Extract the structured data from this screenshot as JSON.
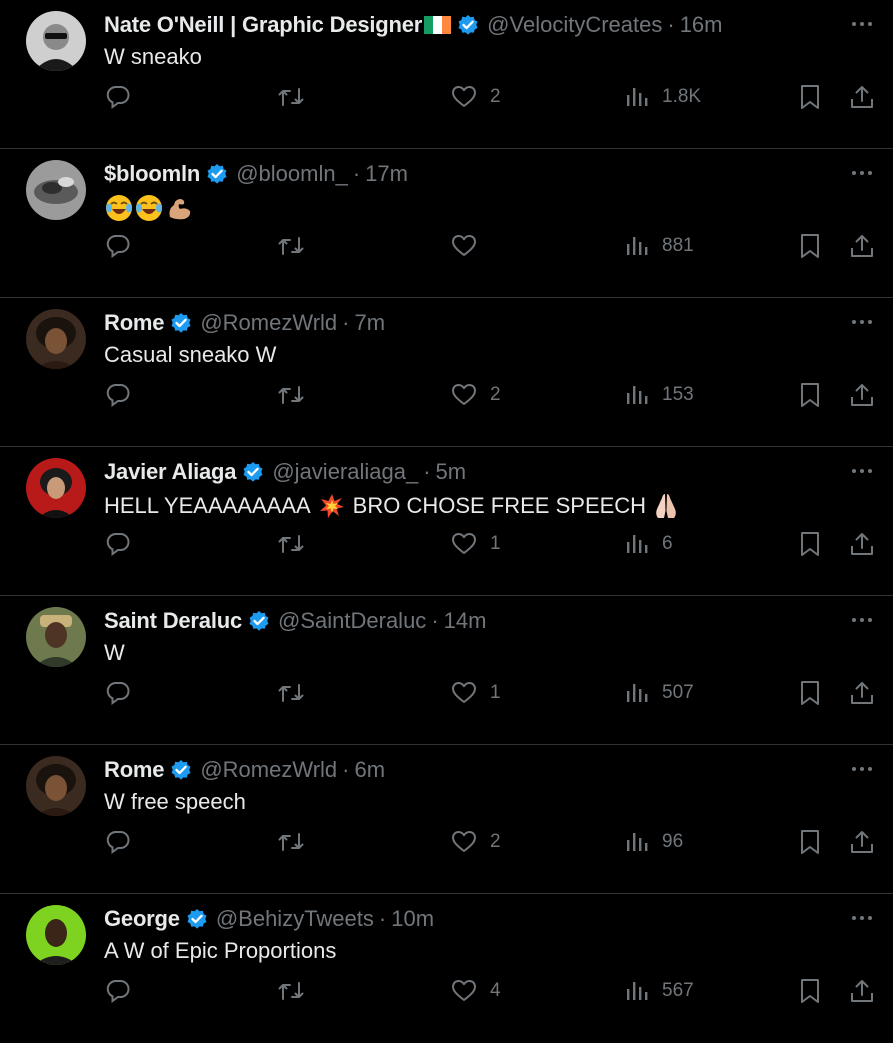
{
  "icons": {
    "reply": "speech-bubble-icon",
    "retweet": "retweet-arrows-icon",
    "like": "heart-icon",
    "views": "bar-chart-icon",
    "bookmark": "bookmark-icon",
    "share": "share-upload-icon",
    "more": "more-dots-icon",
    "verified": "verified-badge-icon"
  },
  "colors": {
    "background": "#000000",
    "text": "#e7e9ea",
    "muted": "#71767b",
    "divider": "#2f3336",
    "verified": "#1d9bf0"
  },
  "tweets": [
    {
      "name": "Nate O'Neill | Graphic Designer",
      "flag": "ireland-flag-icon",
      "handle": "@VelocityCreates",
      "separator": "·",
      "time": "16m",
      "text": "W sneako",
      "likes": "2",
      "views": "1.8K"
    },
    {
      "name": "$bloomln",
      "handle": "@bloomln_",
      "separator": "·",
      "time": "17m",
      "text": "",
      "text_emojis": [
        "face-with-tears-of-joy-emoji",
        "face-with-tears-of-joy-emoji",
        "flexed-biceps-emoji"
      ],
      "likes": "",
      "views": "881"
    },
    {
      "name": "Rome",
      "handle": "@RomezWrld",
      "separator": "·",
      "time": "7m",
      "text": "Casual sneako W",
      "likes": "2",
      "views": "153"
    },
    {
      "name": "Javier Aliaga",
      "handle": "@javieraliaga_",
      "separator": "·",
      "time": "5m",
      "text_parts": [
        "HELL YEAAAAAAAA",
        "BRO CHOSE FREE SPEECH"
      ],
      "text_emojis": [
        "collision-emoji",
        "folded-hands-emoji"
      ],
      "likes": "1",
      "views": "6"
    },
    {
      "name": "Saint Deraluc",
      "handle": "@SaintDeraluc",
      "separator": "·",
      "time": "14m",
      "text": "W",
      "likes": "1",
      "views": "507"
    },
    {
      "name": "Rome",
      "handle": "@RomezWrld",
      "separator": "·",
      "time": "6m",
      "text": "W free speech",
      "likes": "2",
      "views": "96"
    },
    {
      "name": "George",
      "handle": "@BehizyTweets",
      "separator": "·",
      "time": "10m",
      "text": "A W of Epic Proportions",
      "likes": "4",
      "views": "567"
    }
  ]
}
